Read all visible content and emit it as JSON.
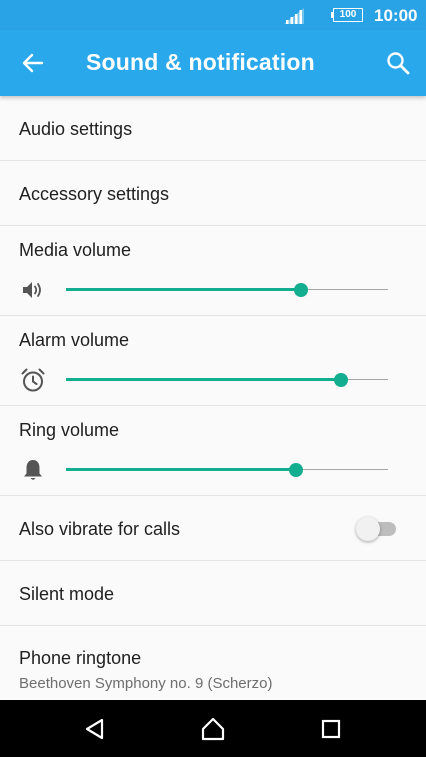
{
  "status_bar": {
    "battery": "100",
    "time": "10:00",
    "icons": [
      "signal-icon",
      "battery-icon"
    ]
  },
  "app_bar": {
    "title": "Sound & notification",
    "icons": [
      "back-arrow-icon",
      "search-icon"
    ]
  },
  "settings": {
    "audio_settings": "Audio settings",
    "accessory_settings": "Accessory settings",
    "media_volume": {
      "label": "Media volume",
      "icon": "speaker-icon",
      "level": 0.73
    },
    "alarm_volume": {
      "label": "Alarm volume",
      "icon": "alarm-clock-icon",
      "level": 0.855
    },
    "ring_volume": {
      "label": "Ring volume",
      "icon": "bell-icon",
      "level": 0.715
    },
    "vibrate_for_calls": {
      "label": "Also vibrate for calls",
      "enabled": false
    },
    "silent_mode": "Silent mode",
    "phone_ringtone": {
      "label": "Phone ringtone",
      "value": "Beethoven Symphony no. 9 (Scherzo)"
    }
  },
  "nav_bar": {
    "icons": [
      "back-triangle-icon",
      "home-icon",
      "recents-icon"
    ]
  },
  "colors": {
    "status_bar": "#29a3e6",
    "app_bar": "#2aa8ec",
    "accent": "#13ad8f",
    "background": "#fafafa"
  }
}
